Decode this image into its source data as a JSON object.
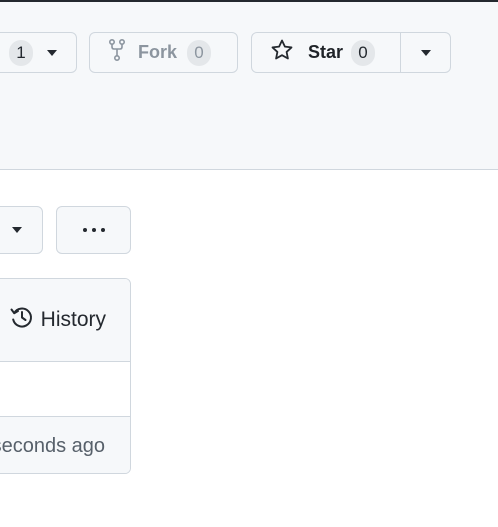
{
  "watch": {
    "count": "1",
    "icon": "caret-down-icon"
  },
  "fork": {
    "label": "Fork",
    "count": "0",
    "icon": "repo-forked-icon"
  },
  "star": {
    "label": "Star",
    "count": "0",
    "icon": "star-icon"
  },
  "toolbar": {
    "more_icon": "kebab-horizontal-icon"
  },
  "file_box": {
    "history_label": "History",
    "history_icon": "history-icon",
    "footer_text": "seconds ago"
  },
  "colors": {
    "header_bg": "#f6f8fa",
    "border": "#d0d7de",
    "muted_text": "#57606a",
    "disabled_text": "#8c959f"
  }
}
